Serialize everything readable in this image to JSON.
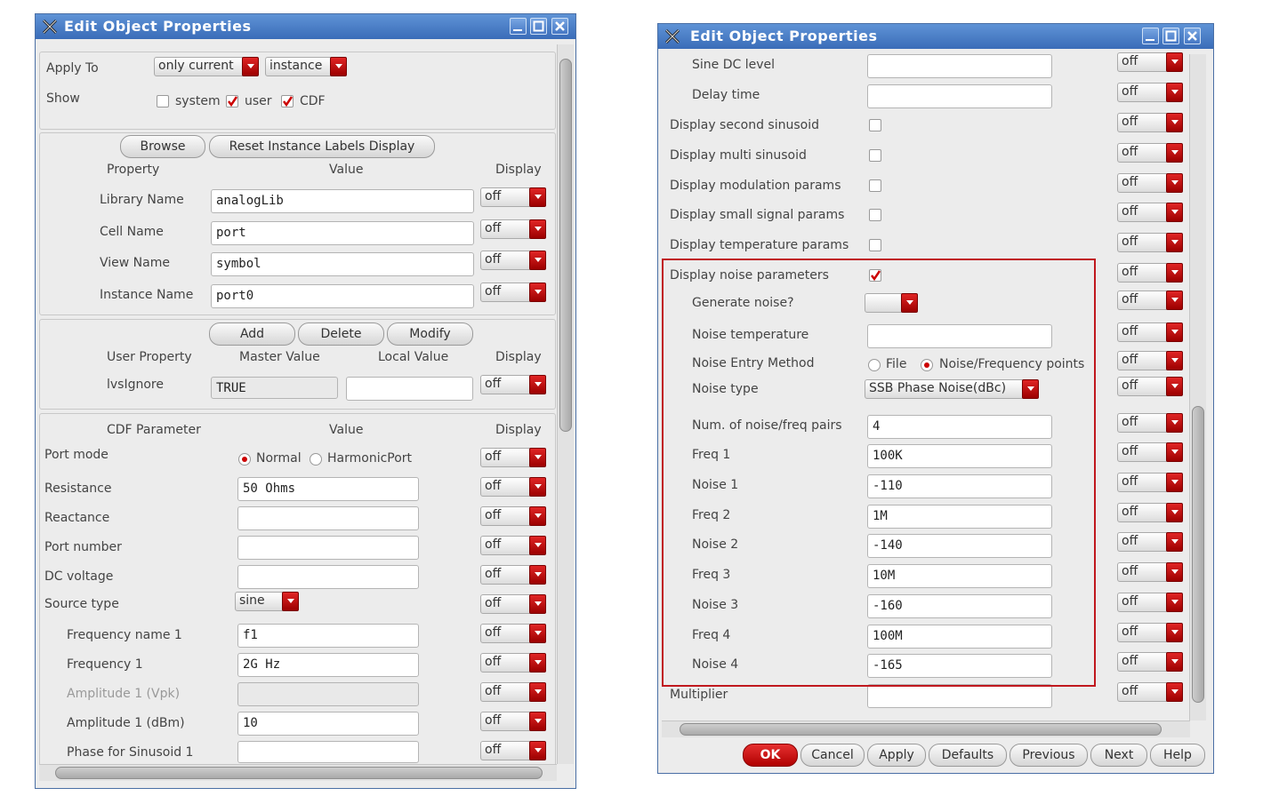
{
  "left": {
    "title": "Edit Object Properties",
    "apply_to_label": "Apply To",
    "apply_to_value": "only current",
    "apply_to_scope": "instance",
    "show_label": "Show",
    "show_system": "system",
    "show_user": "user",
    "show_cdf": "CDF",
    "browse": "Browse",
    "reset": "Reset Instance Labels Display",
    "hdr_property": "Property",
    "hdr_value": "Value",
    "hdr_display": "Display",
    "props": [
      {
        "label": "Library Name",
        "value": "analogLib",
        "display": "off"
      },
      {
        "label": "Cell Name",
        "value": "port",
        "display": "off"
      },
      {
        "label": "View Name",
        "value": "symbol",
        "display": "off"
      },
      {
        "label": "Instance Name",
        "value": "port0",
        "display": "off"
      }
    ],
    "add": "Add",
    "delete": "Delete",
    "modify": "Modify",
    "hdr_user_property": "User Property",
    "hdr_master_value": "Master Value",
    "hdr_local_value": "Local Value",
    "user_prop": {
      "label": "lvsIgnore",
      "master": "TRUE",
      "local": "",
      "display": "off"
    },
    "hdr_cdf": "CDF Parameter",
    "cdf": {
      "port_mode": "Port mode",
      "normal": "Normal",
      "harmonic": "HarmonicPort",
      "resistance": "Resistance",
      "resistance_val": "50 Ohms",
      "reactance": "Reactance",
      "port_number": "Port number",
      "dc_voltage": "DC voltage",
      "source_type": "Source type",
      "source_type_val": "sine",
      "freq_name": "Frequency name 1",
      "freq_name_val": "f1",
      "freq1": "Frequency 1",
      "freq1_val": "2G Hz",
      "amp_vpk": "Amplitude 1 (Vpk)",
      "amp_dbm": "Amplitude 1 (dBm)",
      "amp_dbm_val": "10",
      "phase": "Phase for Sinusoid 1"
    },
    "off": "off"
  },
  "right": {
    "title": "Edit Object Properties",
    "rows": [
      {
        "label": "Sine DC level",
        "indent": true,
        "type": "input",
        "value": ""
      },
      {
        "label": "Delay time",
        "indent": true,
        "type": "input",
        "value": ""
      },
      {
        "label": "Display second sinusoid",
        "indent": false,
        "type": "check",
        "checked": false
      },
      {
        "label": "Display multi sinusoid",
        "indent": false,
        "type": "check",
        "checked": false
      },
      {
        "label": "Display modulation params",
        "indent": false,
        "type": "check",
        "checked": false
      },
      {
        "label": "Display small signal params",
        "indent": false,
        "type": "check",
        "checked": false
      },
      {
        "label": "Display temperature params",
        "indent": false,
        "type": "check",
        "checked": false
      },
      {
        "label": "Display noise parameters",
        "indent": false,
        "type": "check",
        "checked": true
      },
      {
        "label": "Generate noise?",
        "indent": true,
        "type": "combo",
        "value": ""
      },
      {
        "label": "Noise temperature",
        "indent": true,
        "type": "input",
        "value": ""
      },
      {
        "label": "Noise Entry Method",
        "indent": true,
        "type": "radio",
        "opt1": "File",
        "opt2": "Noise/Frequency points"
      },
      {
        "label": "Noise type",
        "indent": true,
        "type": "combo",
        "value": "SSB Phase Noise(dBc)"
      },
      {
        "label": "Num. of noise/freq pairs",
        "indent": true,
        "type": "input",
        "value": "4"
      },
      {
        "label": "Freq 1",
        "indent": true,
        "type": "input",
        "value": "100K"
      },
      {
        "label": "Noise 1",
        "indent": true,
        "type": "input",
        "value": "-110"
      },
      {
        "label": "Freq 2",
        "indent": true,
        "type": "input",
        "value": "1M"
      },
      {
        "label": "Noise 2",
        "indent": true,
        "type": "input",
        "value": "-140"
      },
      {
        "label": "Freq 3",
        "indent": true,
        "type": "input",
        "value": "10M"
      },
      {
        "label": "Noise 3",
        "indent": true,
        "type": "input",
        "value": "-160"
      },
      {
        "label": "Freq 4",
        "indent": true,
        "type": "input",
        "value": "100M"
      },
      {
        "label": "Noise 4",
        "indent": true,
        "type": "input",
        "value": "-165"
      },
      {
        "label": "Multiplier",
        "indent": false,
        "type": "input",
        "value": ""
      }
    ],
    "off": "off",
    "buttons": {
      "ok": "OK",
      "cancel": "Cancel",
      "apply": "Apply",
      "defaults": "Defaults",
      "previous": "Previous",
      "next": "Next",
      "help": "Help"
    }
  }
}
